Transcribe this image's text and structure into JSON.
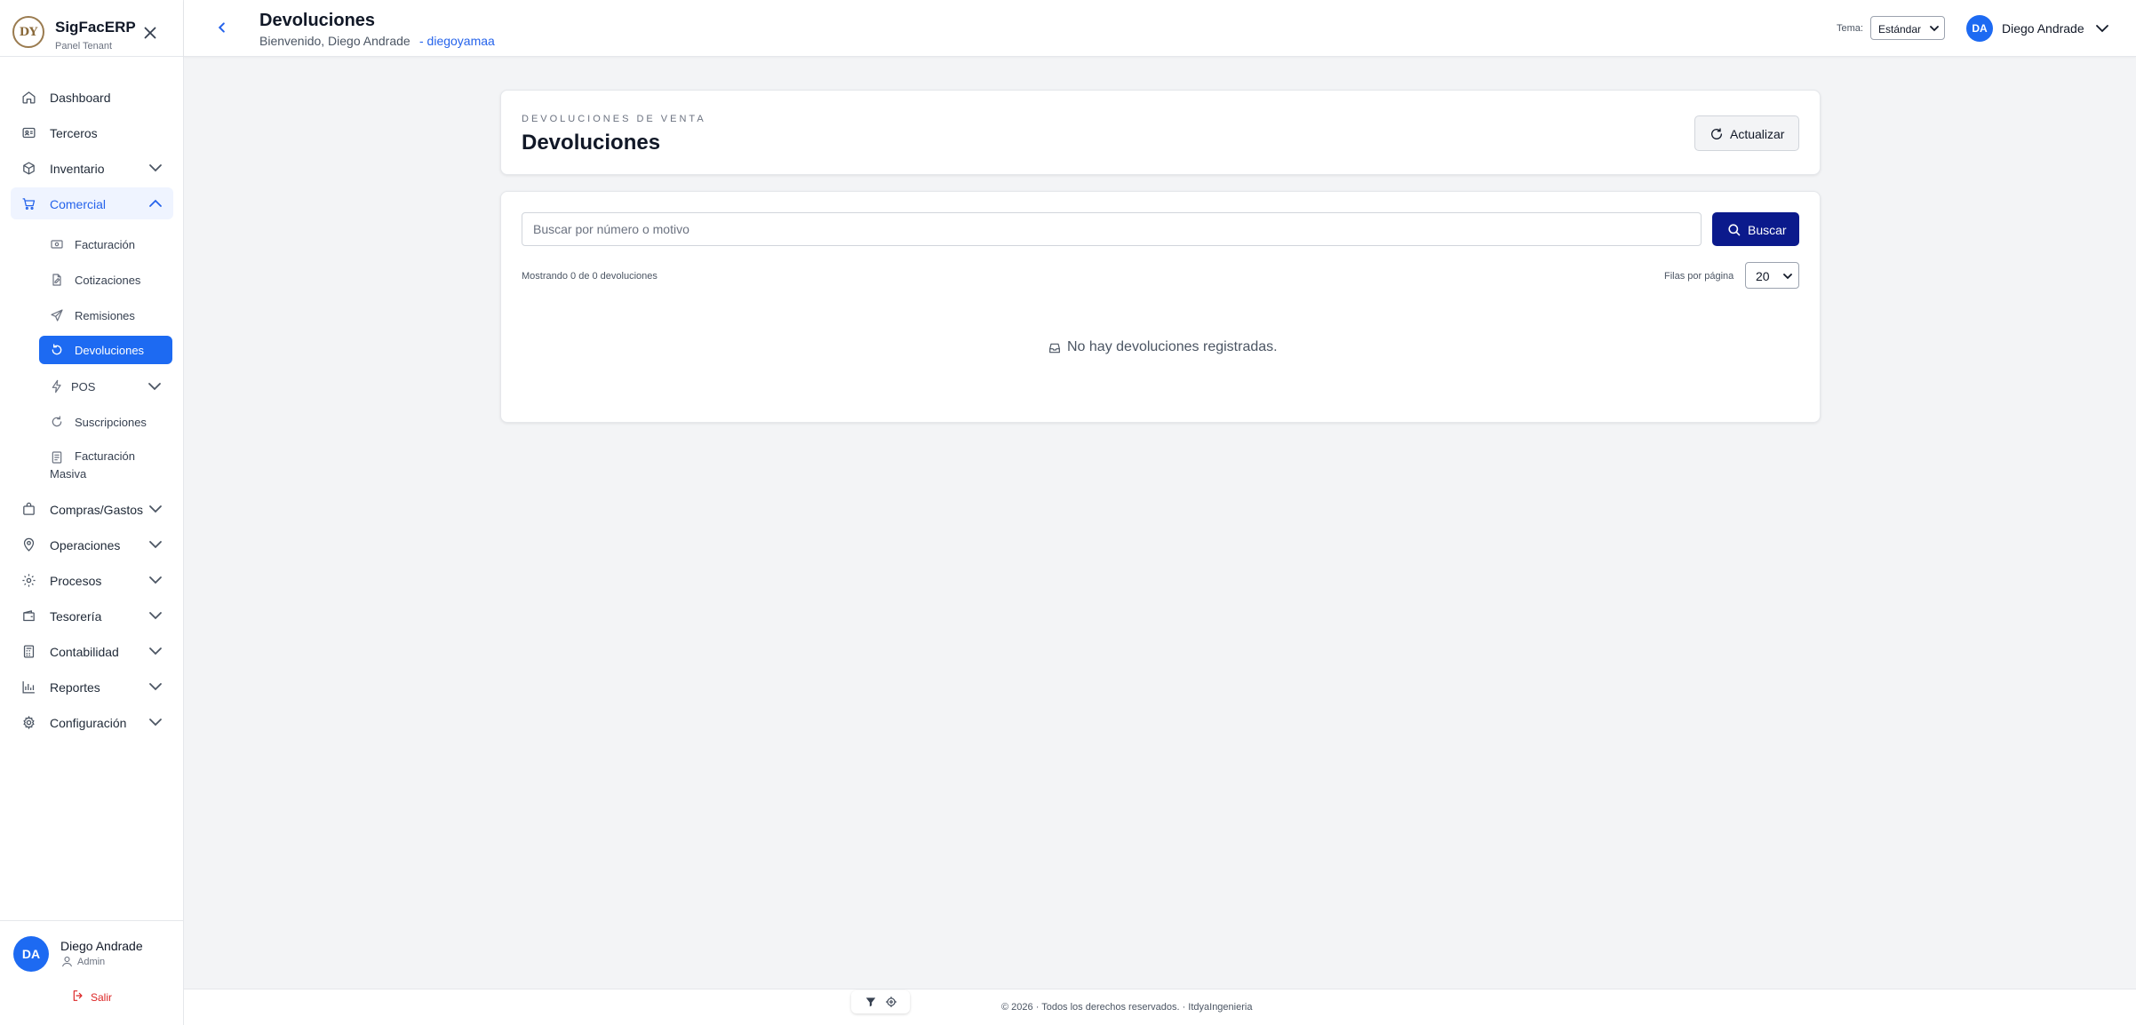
{
  "brand": {
    "logo_text": "DY",
    "title": "SigFacERP",
    "subtitle": "Panel Tenant"
  },
  "sidebar": {
    "items": [
      {
        "label": "Dashboard",
        "icon": "home-icon"
      },
      {
        "label": "Terceros",
        "icon": "id-card-icon"
      },
      {
        "label": "Inventario",
        "icon": "box-icon"
      },
      {
        "label": "Comercial",
        "icon": "cart-icon"
      },
      {
        "label": "Compras/Gastos",
        "icon": "bag-icon"
      },
      {
        "label": "Operaciones",
        "icon": "map-pin-icon"
      },
      {
        "label": "Procesos",
        "icon": "gear-icon"
      },
      {
        "label": "Tesorería",
        "icon": "wallet-icon"
      },
      {
        "label": "Contabilidad",
        "icon": "calculator-icon"
      },
      {
        "label": "Reportes",
        "icon": "bar-chart-icon"
      },
      {
        "label": "Configuración",
        "icon": "settings-icon"
      }
    ],
    "comercial_sub": [
      {
        "label": "Facturación",
        "icon": "banknote-icon"
      },
      {
        "label": "Cotizaciones",
        "icon": "file-edit-icon"
      },
      {
        "label": "Remisiones",
        "icon": "send-icon"
      },
      {
        "label": "Devoluciones",
        "icon": "refresh-icon"
      },
      {
        "label": "POS",
        "icon": "bolt-icon"
      },
      {
        "label": "Suscripciones",
        "icon": "rotate-icon"
      },
      {
        "label": "Facturación Masiva",
        "icon": "document-icon"
      }
    ]
  },
  "user": {
    "initials": "DA",
    "name": "Diego Andrade",
    "role": "Admin",
    "logout_label": "Salir"
  },
  "header": {
    "title": "Devoluciones",
    "welcome": "Bienvenido, Diego Andrade",
    "username": "- diegoyamaa",
    "theme_label": "Tema:",
    "theme_value": "Estándar",
    "user_initials": "DA",
    "user_name": "Diego Andrade"
  },
  "main": {
    "eyebrow": "DEVOLUCIONES DE VENTA",
    "title": "Devoluciones",
    "refresh_label": "Actualizar",
    "search_placeholder": "Buscar por número o motivo",
    "search_label": "Buscar",
    "showing_text": "Mostrando 0 de 0 devoluciones",
    "rows_label": "Filas por página",
    "rows_value": "20",
    "empty_text": "No hay devoluciones registradas."
  },
  "footer": {
    "text": "© 2026 · Todos los derechos reservados. · ItdyaIngenieria"
  },
  "colors": {
    "primary": "#1d6af2",
    "search_button": "#0b1a8c",
    "danger": "#dc2626",
    "link": "#2563eb"
  }
}
